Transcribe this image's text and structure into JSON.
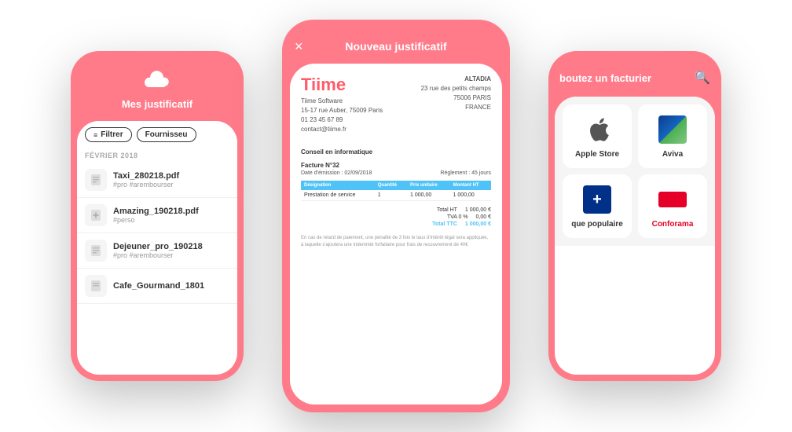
{
  "left_phone": {
    "title": "Mes justificatif",
    "filter_label": "Filtrer",
    "supplier_label": "Fournisseu",
    "month": "FÉVRIER 2018",
    "documents": [
      {
        "name": "Taxi_280218.pdf",
        "tags": "#pro #arembourser"
      },
      {
        "name": "Amazing_190218.pdf",
        "tags": "#perso"
      },
      {
        "name": "Dejeuner_pro_190218",
        "tags": "#pro #arembourser"
      },
      {
        "name": "Cafe_Gourmand_1801",
        "tags": ""
      }
    ]
  },
  "center_phone": {
    "close_label": "×",
    "title": "Nouveau justificatif",
    "invoice": {
      "company_name": "Tiime",
      "from_line1": "Tiime Software",
      "from_line2": "15-17 rue Auber, 75009 Paris",
      "from_line3": "01 23 45 67 89",
      "from_line4": "contact@tiime.fr",
      "to_name": "ALTADIA",
      "to_line1": "23 rue des petits champs",
      "to_line2": "75006  PARIS",
      "to_line3": "FRANCE",
      "category": "Conseil en informatique",
      "ref": "Facture N°32",
      "date_label": "Date d'émission : 02/09/2018",
      "payment_label": "Règlement : 45 jours",
      "table_headers": [
        "Désignation",
        "Quantité",
        "Prix unitaire",
        "Montant HT"
      ],
      "table_rows": [
        {
          "designation": "Prestation de service",
          "qty": "1",
          "price": "1 000,00",
          "total": "1 000,00"
        }
      ],
      "subtotal_label": "Total HT",
      "subtotal_value": "1 000,00 €",
      "tva_label": "TVA 0 %",
      "tva_value": "0,00 €",
      "total_label": "Total TTC",
      "total_value": "1 000,00 €",
      "note": "En cas de retard de paiement, une pénalité de 3 fois le taux d'intérêt légal sera appliquée, à laquelle s'ajoutera une indemnité forfaitaire pour frais de recouvrement de 40€"
    }
  },
  "right_phone": {
    "title": "boutez un facturier",
    "search_icon": "search",
    "suppliers": [
      {
        "name": "Apple Store",
        "type": "apple"
      },
      {
        "name": "Aviva",
        "type": "aviva"
      },
      {
        "name": "que populaire",
        "type": "banque"
      },
      {
        "name": "Conforama",
        "type": "conforama"
      }
    ]
  }
}
